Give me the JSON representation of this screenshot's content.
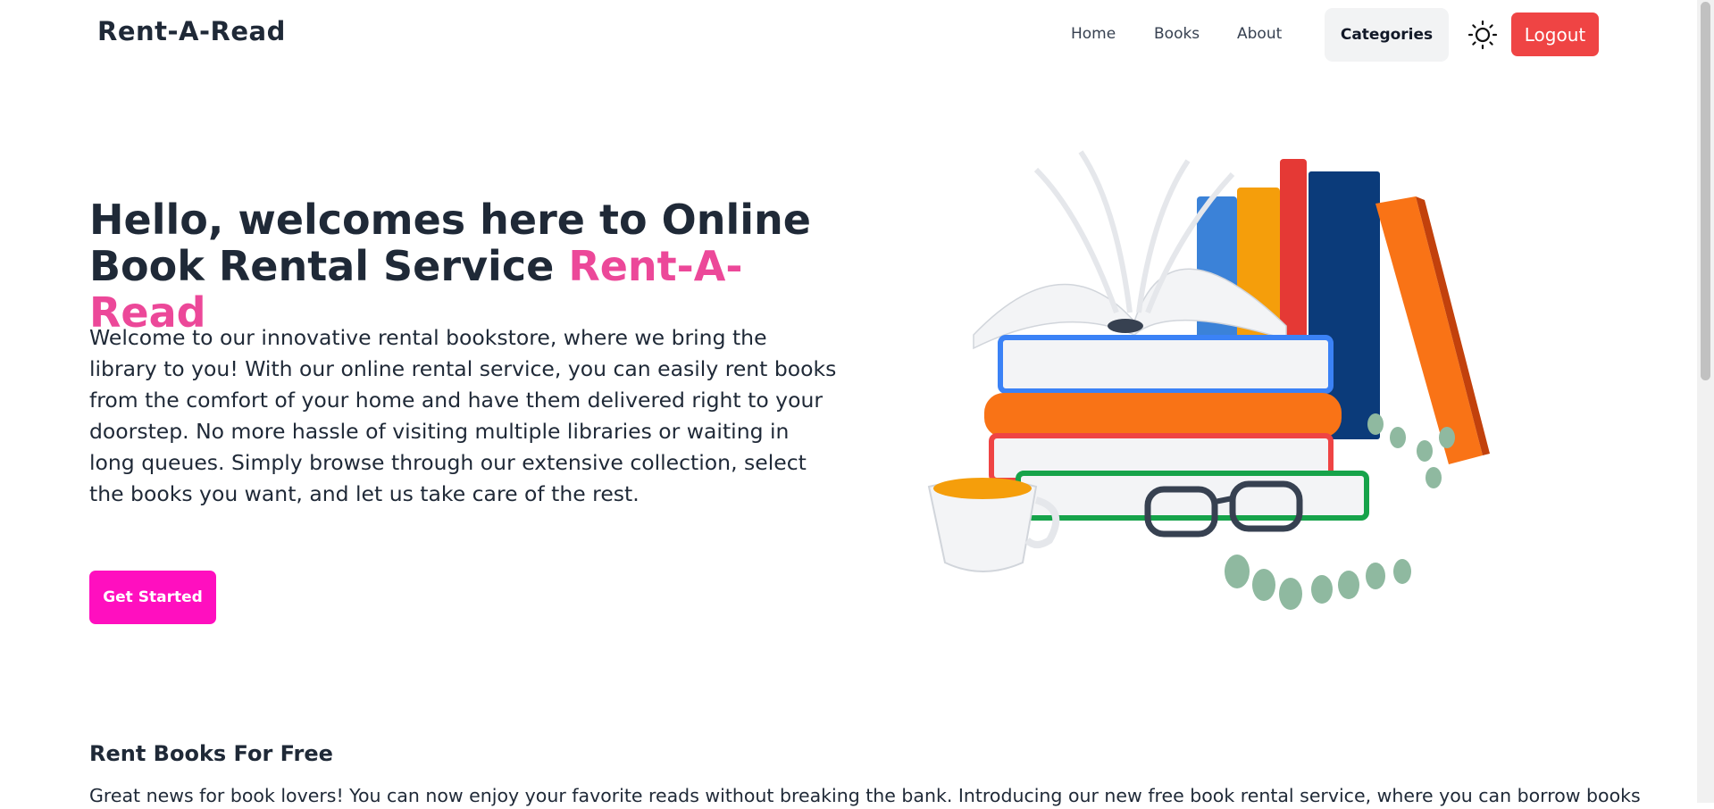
{
  "nav": {
    "brand": "Rent-A-Read",
    "links": [
      "Home",
      "Books",
      "About"
    ],
    "categories_label": "Categories",
    "theme_icon": "sun-icon",
    "logout_label": "Logout"
  },
  "hero": {
    "title_main": "Hello, welcomes here to Online Book Rental Service ",
    "title_accent": "Rent-A-Read",
    "description": "Welcome to our innovative rental bookstore, where we bring the library to you! With our online rental service, you can easily rent books from the comfort of your home and have them delivered right to your doorstep. No more hassle of visiting multiple libraries or waiting in long queues. Simply browse through our extensive collection, select the books you want, and let us take care of the rest.",
    "cta_label": "Get Started"
  },
  "section": {
    "title": "Rent Books For Free",
    "text": "Great news for book lovers! You can now enjoy your favorite reads without breaking the bank. Introducing our new free book rental service, where you can borrow books"
  },
  "colors": {
    "accent": "#ec4899",
    "cta": "#ff0fbf",
    "logout": "#ef4444",
    "text": "#1f2937"
  }
}
